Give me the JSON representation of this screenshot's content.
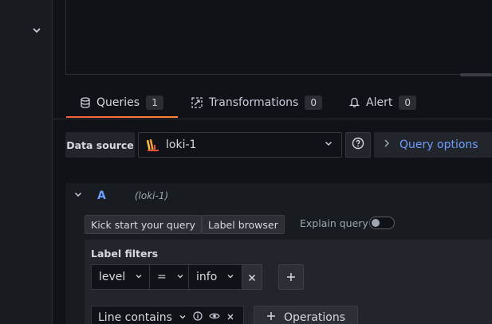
{
  "tabs": [
    {
      "label": "Queries",
      "count": "1",
      "icon": "database-icon"
    },
    {
      "label": "Transformations",
      "count": "0",
      "icon": "transform-icon"
    },
    {
      "label": "Alert",
      "count": "0",
      "icon": "bell-icon"
    }
  ],
  "datasource": {
    "label": "Data source",
    "selected": "loki-1",
    "query_options_label": "Query options"
  },
  "query_row": {
    "ref_id": "A",
    "datasource_name": "(loki-1)"
  },
  "toolbar": {
    "kick_start_label": "Kick start your query",
    "label_browser_label": "Label browser",
    "explain_query_label": "Explain query",
    "explain_query_on": false
  },
  "label_filters": {
    "title": "Label filters",
    "label": "level",
    "operator": "=",
    "value": "info"
  },
  "operations": {
    "first_op": "Line contains",
    "add_label": "Operations"
  },
  "colors": {
    "accent_blue": "#6e9fff",
    "tab_underline": "#f55f3e",
    "background": "#111217"
  }
}
